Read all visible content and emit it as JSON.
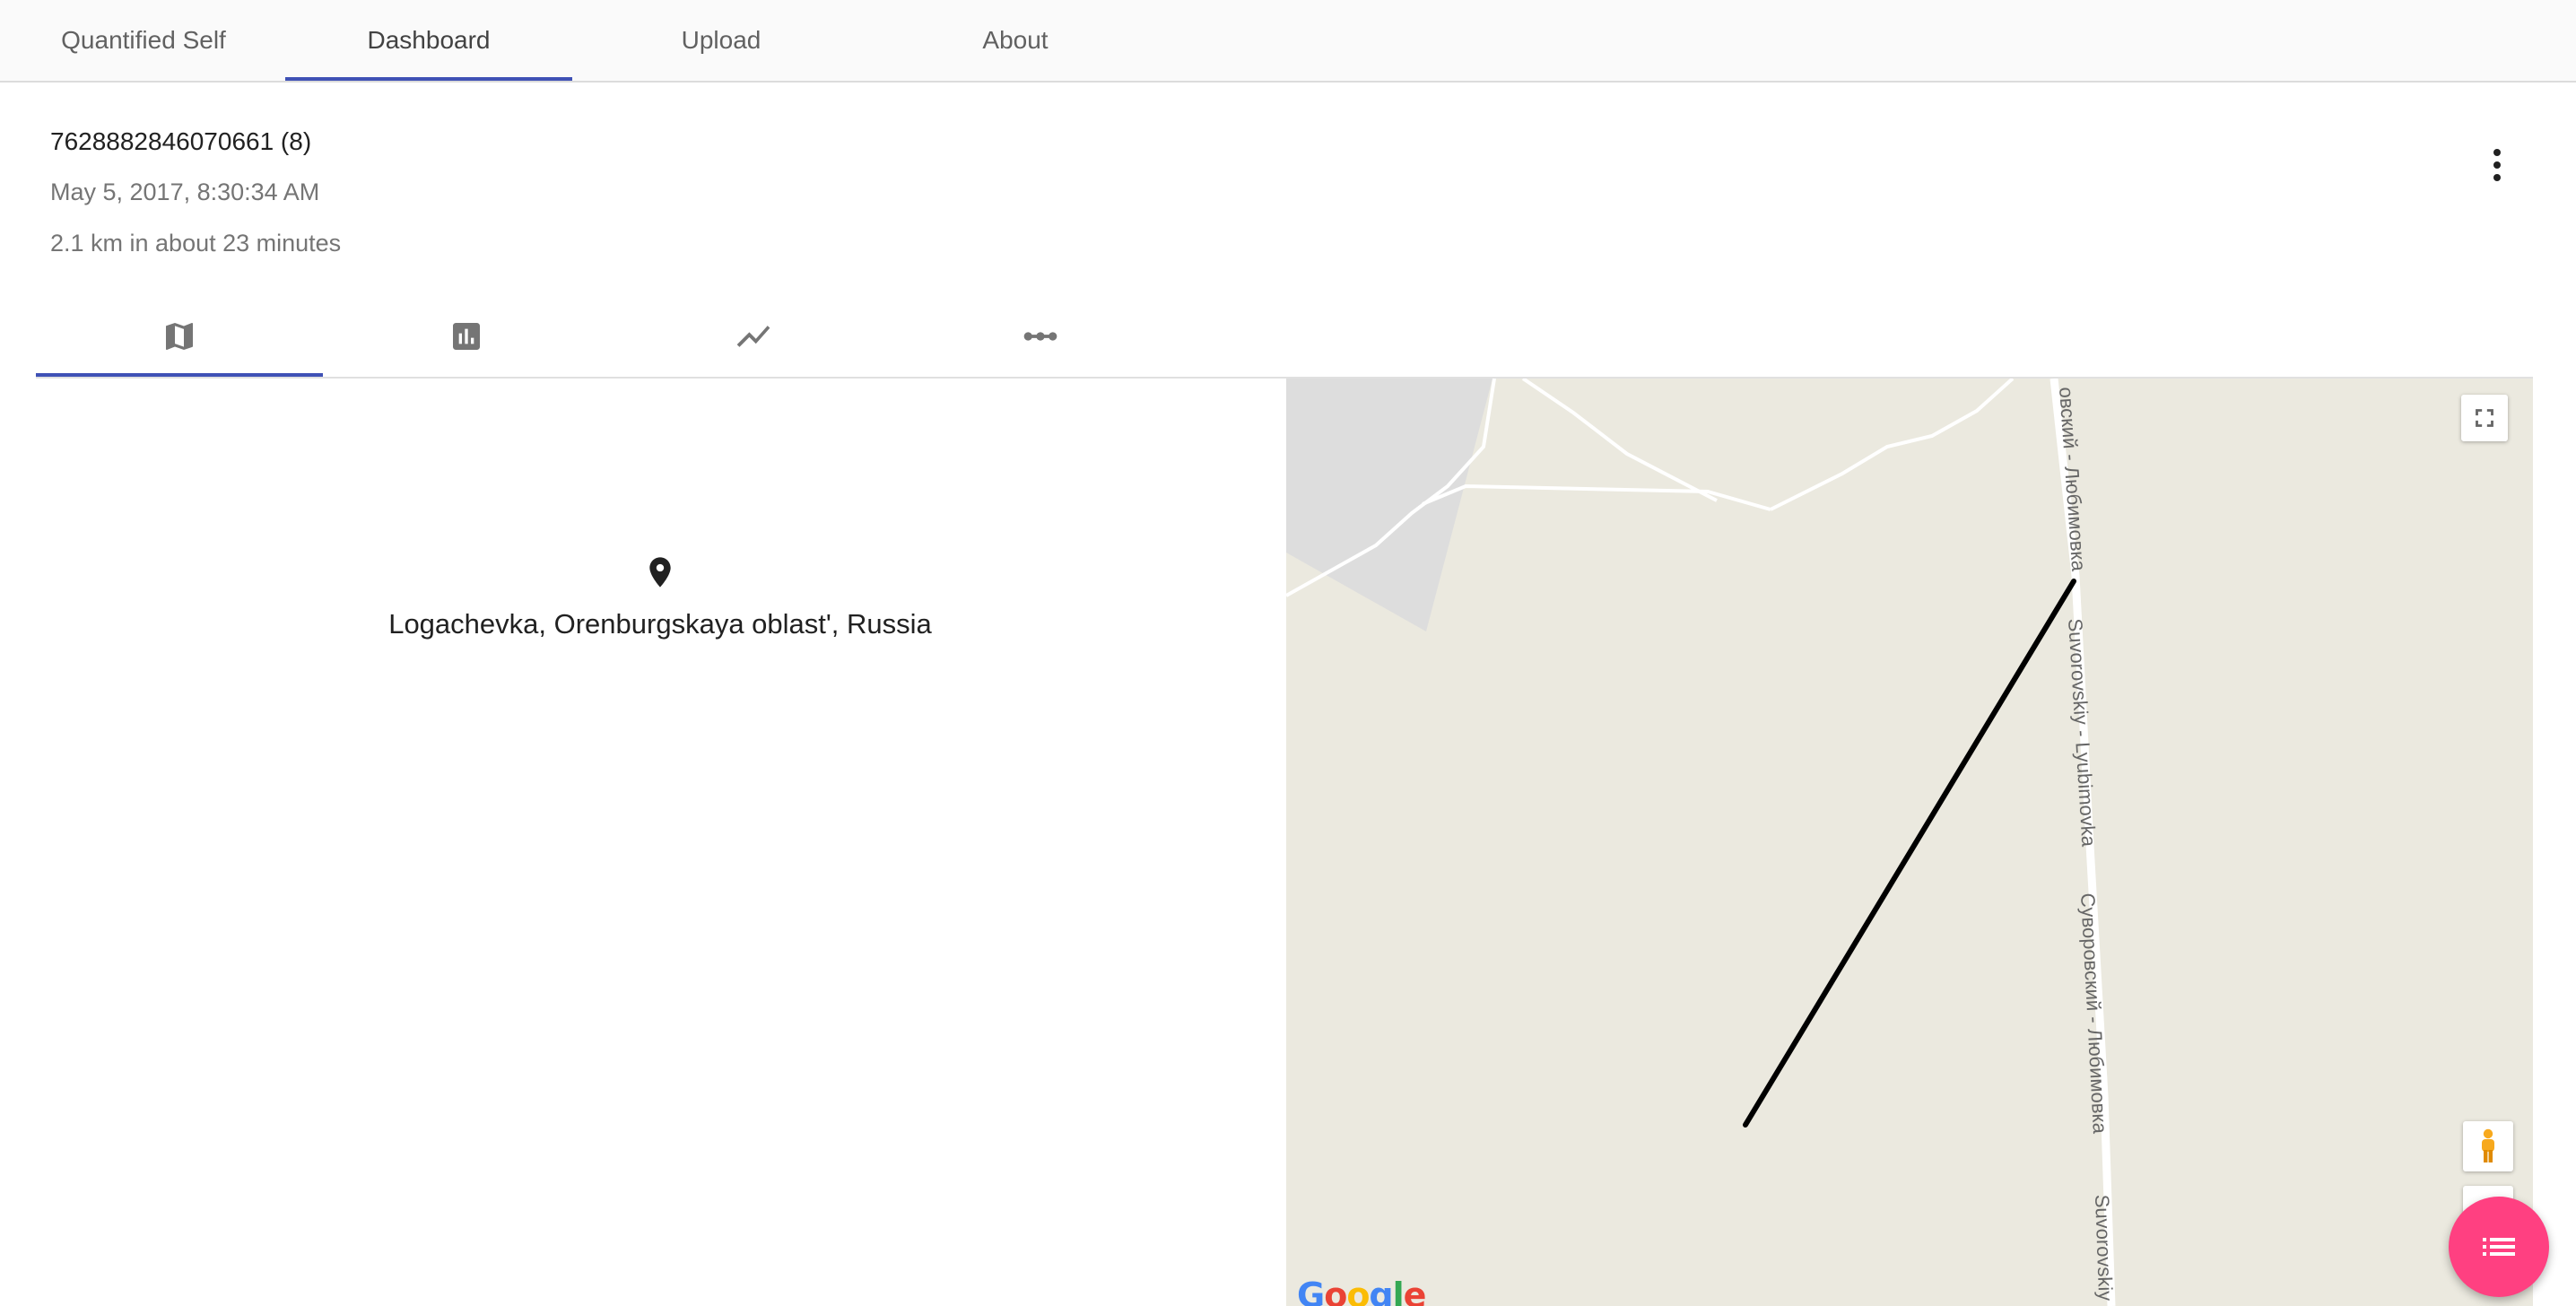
{
  "nav": {
    "tabs": [
      {
        "label": "Quantified Self"
      },
      {
        "label": "Dashboard"
      },
      {
        "label": "Upload"
      },
      {
        "label": "About"
      }
    ],
    "active_tab": "Dashboard"
  },
  "event": {
    "title": "7628882846070661 (8)",
    "date": "May 5, 2017, 8:30:34 AM",
    "summary": "2.1 km in about 23 minutes"
  },
  "subtabs": {
    "items": [
      {
        "icon": "map-icon"
      },
      {
        "icon": "bar-chart-icon"
      },
      {
        "icon": "line-chart-icon"
      },
      {
        "icon": "linear-scale-icon"
      }
    ],
    "active_index": 0
  },
  "location": {
    "icon": "place-icon",
    "name": "Logachevka, Orenburgskaya oblast', Russia"
  },
  "map": {
    "road_labels": [
      "овский - Любимовка",
      "Suvorovskiy - Lyubimovka",
      "Суворовский - Любимовка",
      "Suvorovskiy"
    ],
    "logo_letters": [
      "G",
      "o",
      "o",
      "g",
      "l",
      "e"
    ],
    "colors": {
      "background": "#ebe9df",
      "park": "#dddddd",
      "road": "#ffffff",
      "track": "#000000"
    }
  },
  "fab": {
    "icon": "list-icon",
    "color": "#ff4081"
  }
}
